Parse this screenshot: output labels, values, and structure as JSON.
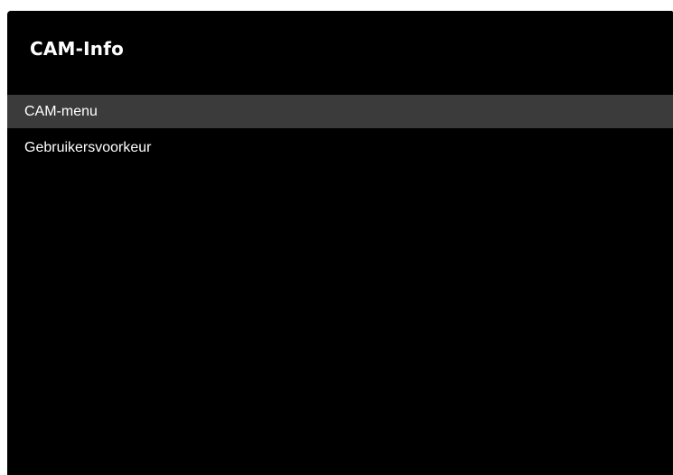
{
  "panel": {
    "title": "CAM-Info"
  },
  "menu": {
    "items": [
      {
        "label": "CAM-menu",
        "selected": true
      },
      {
        "label": "Gebruikersvoorkeur",
        "selected": false
      }
    ]
  },
  "colors": {
    "background": "#000000",
    "selected_row": "#3b3b3b",
    "text": "#ffffff"
  }
}
